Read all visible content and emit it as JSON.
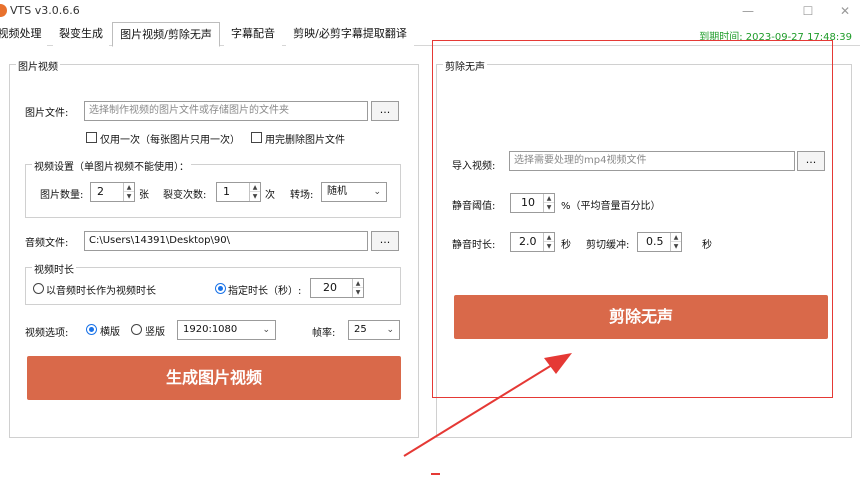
{
  "window": {
    "title": "VTS v3.0.6.6",
    "minimize_glyph": "—",
    "maximize_glyph": "☐",
    "close_glyph": "✕"
  },
  "tabs": [
    {
      "label": "视频处理"
    },
    {
      "label": "裂变生成"
    },
    {
      "label": "图片视频/剪除无声"
    },
    {
      "label": "字幕配音"
    },
    {
      "label": "剪映/必剪字幕提取翻译"
    }
  ],
  "expiry": {
    "label": "到期时间:",
    "value": "2023-09-27 17:48:39"
  },
  "left": {
    "group_title": "图片视频",
    "image_file": {
      "label": "图片文件:",
      "placeholder": "选择制作视频的图片文件或存储图片的文件夹",
      "browse": "..."
    },
    "use_once": "仅用一次（每张图片只用一次）",
    "delete_after": "用完删除图片文件",
    "settings_title": "视频设置（单图片视频不能使用）：",
    "image_count": {
      "label": "图片数量:",
      "value": "2",
      "unit": "张"
    },
    "fission_count": {
      "label": "裂变次数:",
      "value": "1",
      "unit": "次"
    },
    "transition": {
      "label": "转场:",
      "value": "随机"
    },
    "audio_file": {
      "label": "音频文件:",
      "value": "C:\\Users\\14391\\Desktop\\90\\",
      "browse": "..."
    },
    "duration_title": "视频时长",
    "duration_audio": "以音频时长作为视频时长",
    "duration_fixed": "指定时长（秒）:",
    "duration_value": "20",
    "options_label": "视频选项:",
    "landscape": "横版",
    "portrait": "竖版",
    "resolution": "1920:1080",
    "fps_label": "帧率:",
    "fps_value": "25",
    "generate_button": "生成图片视频"
  },
  "right": {
    "group_title": "剪除无声",
    "import_video": {
      "label": "导入视频:",
      "placeholder": "选择需要处理的mp4视频文件",
      "browse": "..."
    },
    "threshold": {
      "label": "静音阈值:",
      "value": "10",
      "unit": "%（平均音量百分比）"
    },
    "silence_duration": {
      "label": "静音时长:",
      "value": "2.0",
      "unit": "秒"
    },
    "cut_buffer": {
      "label": "剪切缓冲:",
      "value": "0.5",
      "unit": "秒"
    },
    "cut_button": "剪除无声"
  },
  "colors": {
    "accent_button": "#d9694a",
    "annotation_red": "#e53935",
    "expiry_green": "#1f9c2a"
  }
}
